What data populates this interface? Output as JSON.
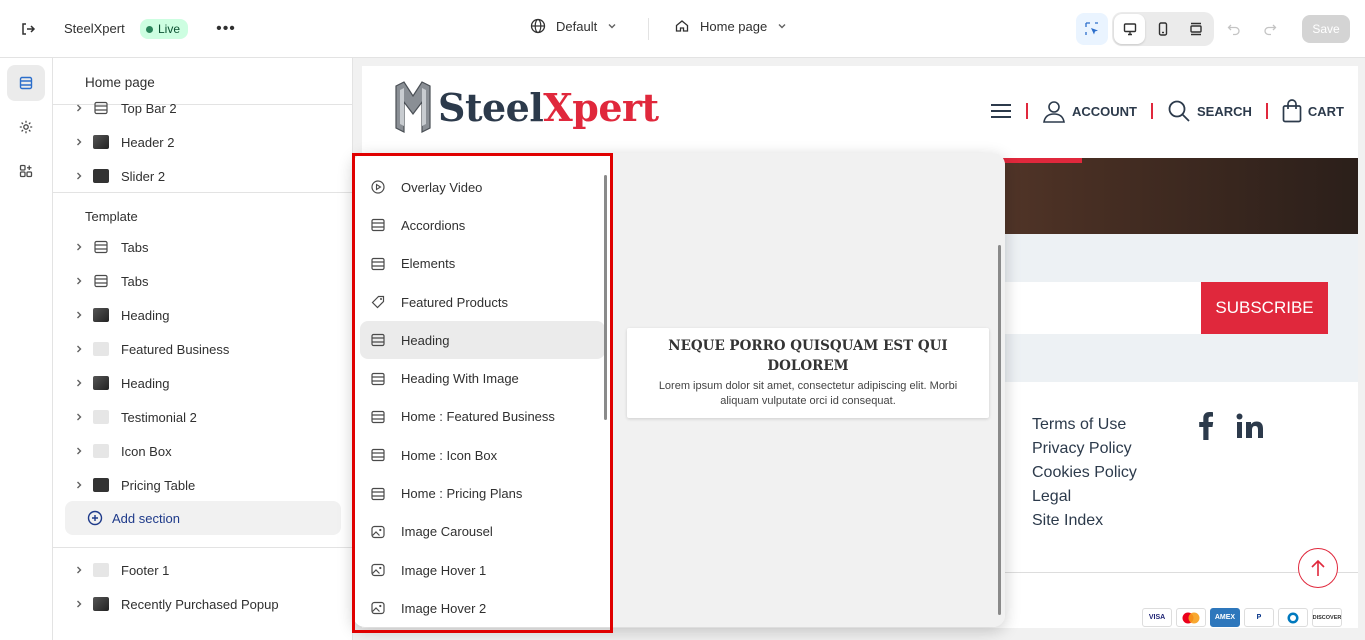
{
  "topbar": {
    "store_name": "SteelXpert",
    "status": "Live",
    "theme": "Default",
    "page": "Home page",
    "save_label": "Save"
  },
  "sidebar": {
    "title": "Home page",
    "header_items": [
      {
        "label": "Top Bar 2",
        "icon": "section-icon"
      },
      {
        "label": "Header 2",
        "icon": "image-thumb"
      },
      {
        "label": "Slider 2",
        "icon": "image-thumb"
      }
    ],
    "template_label": "Template",
    "template_items": [
      {
        "label": "Tabs",
        "icon": "section-icon"
      },
      {
        "label": "Tabs",
        "icon": "section-icon"
      },
      {
        "label": "Heading",
        "icon": "image-thumb"
      },
      {
        "label": "Featured Business",
        "icon": "image-thumb"
      },
      {
        "label": "Heading",
        "icon": "image-thumb"
      },
      {
        "label": "Testimonial 2",
        "icon": "image-thumb"
      },
      {
        "label": "Icon Box",
        "icon": "image-thumb"
      },
      {
        "label": "Pricing Table",
        "icon": "image-thumb"
      }
    ],
    "add_section": "Add section",
    "footer_items": [
      {
        "label": "Footer 1",
        "icon": "image-thumb"
      },
      {
        "label": "Recently Purchased Popup",
        "icon": "image-thumb"
      }
    ]
  },
  "popover": {
    "items": [
      {
        "label": "Overlay Video",
        "icon": "play-circle-icon"
      },
      {
        "label": "Accordions",
        "icon": "section-icon"
      },
      {
        "label": "Elements",
        "icon": "section-icon"
      },
      {
        "label": "Featured Products",
        "icon": "tag-icon"
      },
      {
        "label": "Heading",
        "icon": "section-icon"
      },
      {
        "label": "Heading With Image",
        "icon": "section-icon"
      },
      {
        "label": "Home : Featured Business",
        "icon": "section-icon"
      },
      {
        "label": "Home : Icon Box",
        "icon": "section-icon"
      },
      {
        "label": "Home : Pricing Plans",
        "icon": "section-icon"
      },
      {
        "label": "Image Carousel",
        "icon": "image-icon"
      },
      {
        "label": "Image Hover 1",
        "icon": "image-icon"
      },
      {
        "label": "Image Hover 2",
        "icon": "image-icon"
      }
    ],
    "active_index": 4,
    "preview_heading": "NEQUE PORRO QUISQUAM EST QUI DOLOREM",
    "preview_text": "Lorem ipsum dolor sit amet, consectetur adipiscing elit. Morbi aliquam vulputate orci id consequat."
  },
  "preview": {
    "brand_steel": "Steel",
    "brand_xpert": "Xpert",
    "nav": {
      "account": "ACCOUNT",
      "search": "SEARCH",
      "cart": "CART"
    },
    "subscribe": "SUBSCRIBE",
    "footer_links": [
      "Terms of Use",
      "Privacy Policy",
      "Cookies Policy",
      "Legal",
      "Site Index"
    ],
    "payments": [
      "VISA",
      "",
      "AMEX",
      "P",
      "",
      "DISCOVER"
    ]
  },
  "colors": {
    "accent": "#e0283c",
    "brand_dark": "#2c3a4b",
    "highlight": "#e00000"
  }
}
